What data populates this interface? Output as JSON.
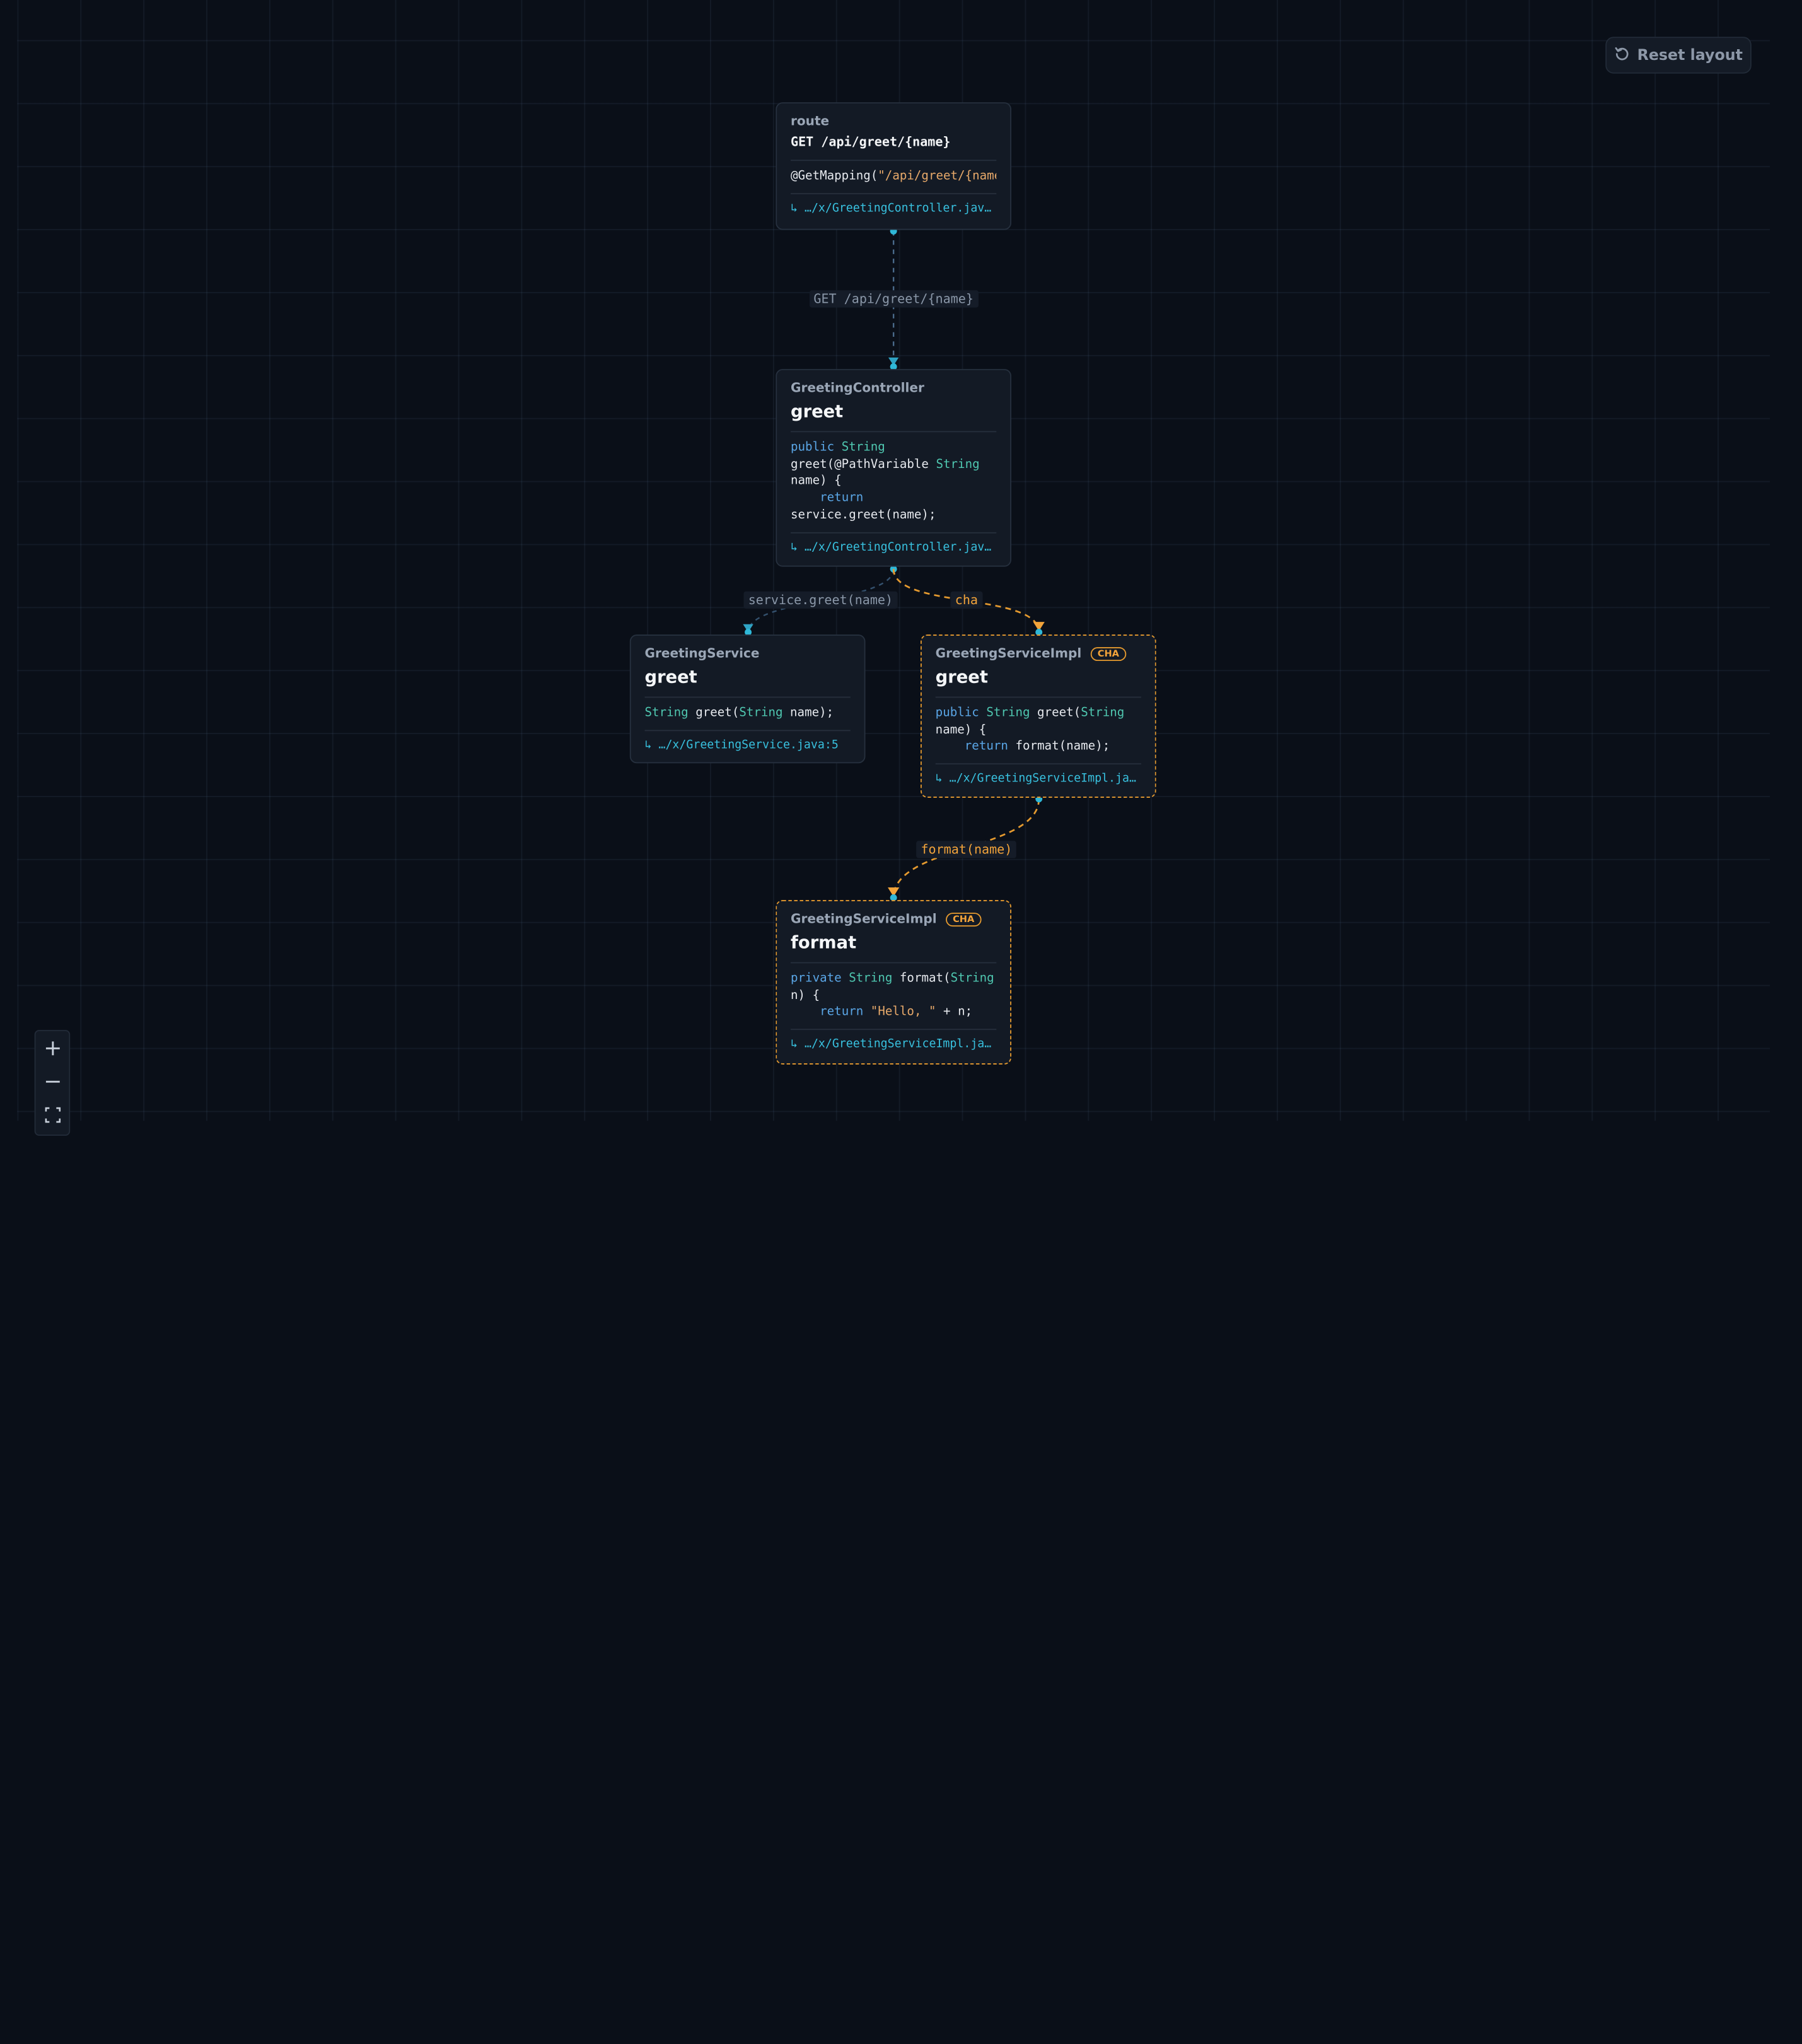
{
  "toolbar": {
    "reset_label": "Reset layout",
    "reset_icon": "reset-icon"
  },
  "zoom_controls": {
    "icons": [
      "plus-icon",
      "minus-icon",
      "fit-view-icon"
    ]
  },
  "colors": {
    "background": "#0a0f18",
    "node": "#131a25",
    "accent": "#38c0de",
    "cha": "#e59a2f"
  },
  "nodes": {
    "route": {
      "class": "route",
      "method": "GET /api/greet/{name}",
      "code": "@GetMapping(\"/api/greet/{name",
      "location": "↳ …/x/GreetingController.java…"
    },
    "controller": {
      "class": "GreetingController",
      "method": "greet",
      "code": "public String\ngreet(@PathVariable String\nname) {\n    return\nservice.greet(name);",
      "location": "↳ …/x/GreetingController.java…"
    },
    "service": {
      "class": "GreetingService",
      "method": "greet",
      "code": "String greet(String name);",
      "location": "↳ …/x/GreetingService.java:5"
    },
    "impl_greet": {
      "class": "GreetingServiceImpl",
      "badge": "CHA",
      "method": "greet",
      "code": "public String greet(String\nname) {\n    return format(name);",
      "location": "↳ …/x/GreetingServiceImpl.jav…"
    },
    "impl_format": {
      "class": "GreetingServiceImpl",
      "badge": "CHA",
      "method": "format",
      "code": "private String format(String\nn) {\n    return \"Hello, \" + n;",
      "location": "↳ …/x/GreetingServiceImpl.jav…"
    }
  },
  "edges": {
    "route_to_controller": "GET /api/greet/{name}",
    "controller_to_service": "service.greet(name)",
    "controller_to_impl": "cha",
    "impl_to_format": "format(name)"
  }
}
